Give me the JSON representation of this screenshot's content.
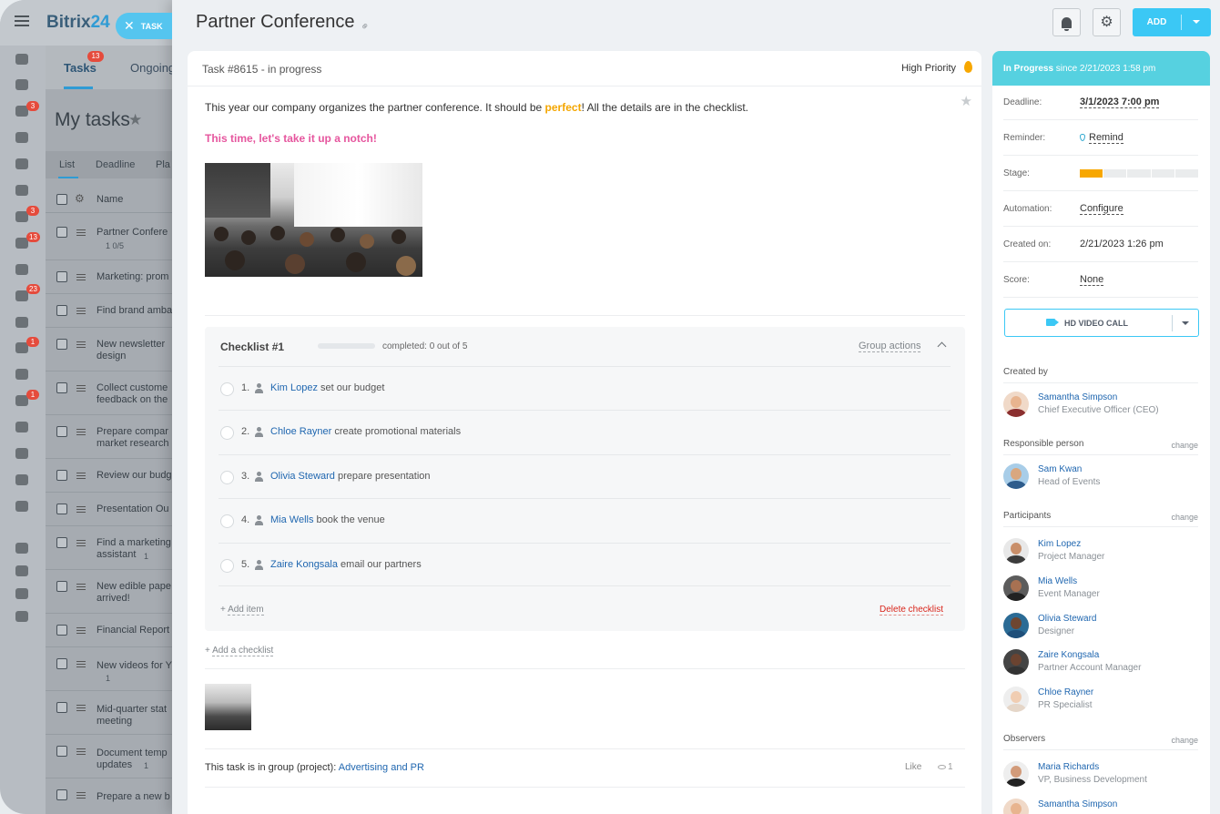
{
  "background_app": {
    "logo_main": "Bitrix",
    "logo_num": "24",
    "slider_tag": "TASK",
    "rail_badges": [
      "3",
      "3",
      "13",
      "23",
      "1",
      "1"
    ],
    "tabs": [
      {
        "label": "Tasks",
        "badge": "13"
      },
      {
        "label": "Ongoing"
      }
    ],
    "heading": "My tasks",
    "filters": [
      "List",
      "Deadline",
      "Pla"
    ],
    "column_name": "Name",
    "rows": [
      {
        "text": "Partner Confere",
        "meta": "1   0/5"
      },
      {
        "text": "Marketing: prom"
      },
      {
        "text": "Find brand amba"
      },
      {
        "text": "New newsletter\ndesign"
      },
      {
        "text": "Collect custome\nfeedback on the"
      },
      {
        "text": "Prepare compar\nmarket research"
      },
      {
        "text": "Review our budg"
      },
      {
        "text": "Presentation Ou"
      },
      {
        "text": "Find a marketing\nassistant",
        "meta": "1"
      },
      {
        "text": "New edible pape\narrived!"
      },
      {
        "text": "Financial Report"
      },
      {
        "text": "New videos for Y",
        "meta": "1"
      },
      {
        "text": "Mid-quarter stat\nmeeting"
      },
      {
        "text": "Document temp\nupdates",
        "meta": "1"
      },
      {
        "text": "Prepare a new b"
      }
    ]
  },
  "header": {
    "title": "Partner Conference",
    "add_label": "ADD"
  },
  "task": {
    "number_status": "Task #8615 - in progress",
    "priority": "High Priority",
    "desc_before": "This year our company organizes the partner conference. It should be ",
    "desc_highlight": "perfect",
    "desc_after": "! All the details are in the checklist.",
    "tagline": "This time, let's take it up a notch!",
    "group_prefix": "This task is in group (project): ",
    "group_name": "Advertising and PR",
    "like_label": "Like",
    "views": "1"
  },
  "checklist": {
    "title": "Checklist #1",
    "progress": 0,
    "count_text": "completed: 0 out of 5",
    "group_actions": "Group actions",
    "items": [
      {
        "num": "1.",
        "person": "Kim Lopez",
        "text": " set our budget"
      },
      {
        "num": "2.",
        "person": "Chloe Rayner",
        "text": " create promotional materials"
      },
      {
        "num": "3.",
        "person": "Olivia Steward",
        "text": " prepare presentation"
      },
      {
        "num": "4.",
        "person": "Mia Wells",
        "text": " book the venue"
      },
      {
        "num": "5.",
        "person": "Zaire Kongsala",
        "text": " email our partners"
      }
    ],
    "add_item": "Add item",
    "delete": "Delete checklist",
    "add_checklist": "Add a checklist"
  },
  "sidebar": {
    "status_label": "In Progress",
    "status_since": " since 2/21/2023 1:58 pm",
    "fields": {
      "deadline_k": "Deadline:",
      "deadline_v": "3/1/2023 7:00 pm",
      "reminder_k": "Reminder:",
      "reminder_v": "Remind",
      "stage_k": "Stage:",
      "stage_filled": 1,
      "stage_total": 5,
      "automation_k": "Automation:",
      "automation_v": "Configure",
      "created_k": "Created on:",
      "created_v": "2/21/2023 1:26 pm",
      "score_k": "Score:",
      "score_v": "None"
    },
    "video_call": "HD VIDEO CALL",
    "change": "change",
    "created_by_title": "Created by",
    "created_by": {
      "name": "Samantha Simpson",
      "role": "Chief Executive Officer (CEO)"
    },
    "responsible_title": "Responsible person",
    "responsible": {
      "name": "Sam Kwan",
      "role": "Head of Events"
    },
    "participants_title": "Participants",
    "participants": [
      {
        "name": "Kim Lopez",
        "role": "Project Manager"
      },
      {
        "name": "Mia Wells",
        "role": "Event Manager"
      },
      {
        "name": "Olivia Steward",
        "role": "Designer"
      },
      {
        "name": "Zaire Kongsala",
        "role": "Partner Account Manager"
      },
      {
        "name": "Chloe Rayner",
        "role": "PR Specialist"
      }
    ],
    "observers_title": "Observers",
    "observers": [
      {
        "name": "Maria Richards",
        "role": "VP, Business Development"
      },
      {
        "name": "Samantha Simpson",
        "role": ""
      }
    ]
  }
}
